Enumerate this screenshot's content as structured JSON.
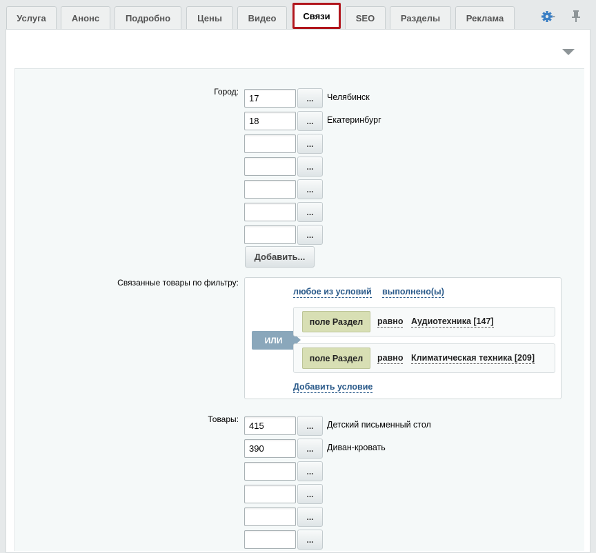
{
  "tabs": [
    "Услуга",
    "Анонс",
    "Подробно",
    "Цены",
    "Видео",
    "Связи",
    "SEO",
    "Разделы",
    "Реклама"
  ],
  "active_tab": "Связи",
  "icons": {
    "settings": "gear-icon",
    "pin": "pin-icon",
    "collapse": "triangle-down-icon"
  },
  "city": {
    "label": "Город:",
    "rows": [
      {
        "value": "17",
        "name": "Челябинск"
      },
      {
        "value": "18",
        "name": "Екатеринбург"
      },
      {
        "value": "",
        "name": ""
      },
      {
        "value": "",
        "name": ""
      },
      {
        "value": "",
        "name": ""
      },
      {
        "value": "",
        "name": ""
      },
      {
        "value": "",
        "name": ""
      }
    ],
    "browse_label": "...",
    "add_label": "Добавить..."
  },
  "filter": {
    "label": "Связанные товары по фильтру:",
    "any_link": "любое из условий",
    "done_link": "выполнено(ы)",
    "or_label": "ИЛИ",
    "conditions": [
      {
        "field": "поле Раздел",
        "op": "равно",
        "value": "Аудиотехника [147]"
      },
      {
        "field": "поле Раздел",
        "op": "равно",
        "value": "Климатическая техника [209]"
      }
    ],
    "add_condition": "Добавить условие"
  },
  "goods": {
    "label": "Товары:",
    "rows": [
      {
        "value": "415",
        "name": "Детский письменный стол"
      },
      {
        "value": "390",
        "name": "Диван-кровать"
      },
      {
        "value": "",
        "name": ""
      },
      {
        "value": "",
        "name": ""
      },
      {
        "value": "",
        "name": ""
      },
      {
        "value": "",
        "name": ""
      }
    ],
    "browse_label": "..."
  },
  "colors": {
    "active_tab_border": "#b1151c",
    "link": "#2a5a8a",
    "or_badge": "#8aa7bb",
    "field_button": "#d8dfb4"
  }
}
